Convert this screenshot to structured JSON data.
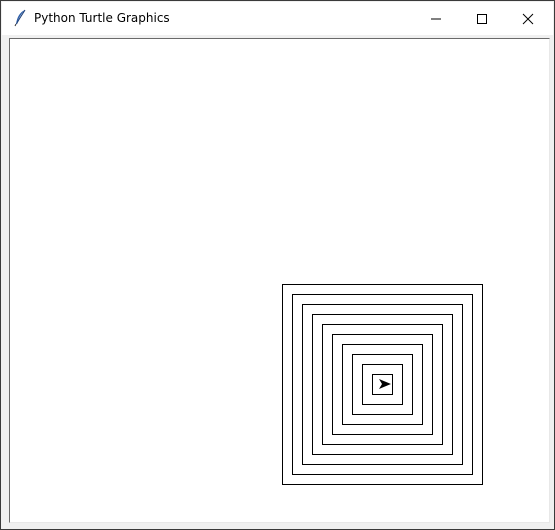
{
  "window": {
    "title": "Python Turtle Graphics",
    "icon": "feather-icon"
  },
  "controls": {
    "minimize_icon": "minimize-icon",
    "maximize_icon": "maximize-icon",
    "close_icon": "close-icon"
  },
  "drawing": {
    "shape": "square-spiral",
    "turtle_heading": "east",
    "turtle_icon": "turtle-arrow-icon",
    "line_color": "#000000",
    "background_color": "#ffffff"
  }
}
